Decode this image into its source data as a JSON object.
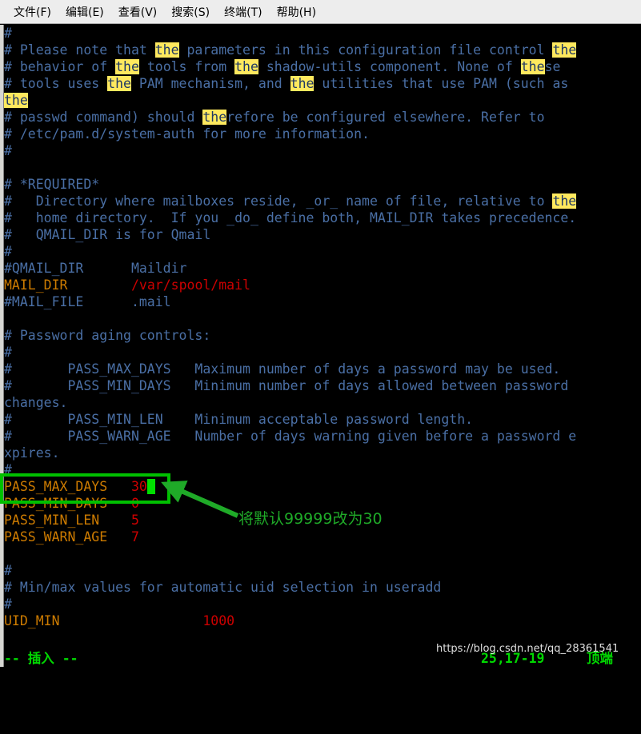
{
  "window": {
    "app": "terminal",
    "editor": "vim",
    "file_type": "login.defs"
  },
  "menubar": {
    "items": [
      {
        "label": "文件(F)",
        "name": "menu-file"
      },
      {
        "label": "编辑(E)",
        "name": "menu-edit"
      },
      {
        "label": "查看(V)",
        "name": "menu-view"
      },
      {
        "label": "搜索(S)",
        "name": "menu-search"
      },
      {
        "label": "终端(T)",
        "name": "menu-terminal"
      },
      {
        "label": "帮助(H)",
        "name": "menu-help"
      }
    ]
  },
  "terminal": {
    "background": "#000000",
    "comment_color": "#4a6fa5",
    "key_color": "#cd7b00",
    "value_color": "#cd0000",
    "search_highlight_bg": "#ffe95e",
    "search_highlight_fg": "#1f3864",
    "search_term": "the",
    "cursor_color": "#00e000",
    "lines": [
      "#",
      "# Please note that the parameters in this configuration file control the",
      "# behavior of the tools from the shadow-utils component. None of these",
      "# tools uses the PAM mechanism, and the utilities that use PAM (such as",
      "the",
      "# passwd command) should therefore be configured elsewhere. Refer to",
      "# /etc/pam.d/system-auth for more information.",
      "#",
      "",
      "# *REQUIRED*",
      "#   Directory where mailboxes reside, _or_ name of file, relative to the",
      "#   home directory.  If you _do_ define both, MAIL_DIR takes precedence.",
      "#   QMAIL_DIR is for Qmail",
      "#",
      "#QMAIL_DIR      Maildir",
      "MAIL_DIR        /var/spool/mail",
      "#MAIL_FILE      .mail",
      "",
      "# Password aging controls:",
      "#",
      "#       PASS_MAX_DAYS   Maximum number of days a password may be used.",
      "#       PASS_MIN_DAYS   Minimum number of days allowed between password",
      "changes.",
      "#       PASS_MIN_LEN    Minimum acceptable password length.",
      "#       PASS_WARN_AGE   Number of days warning given before a password e",
      "xpires.",
      "#",
      "PASS_MAX_DAYS   30",
      "PASS_MIN_DAYS   0",
      "PASS_MIN_LEN    5",
      "PASS_WARN_AGE   7",
      "",
      "#",
      "# Min/max values for automatic uid selection in useradd",
      "#",
      "UID_MIN                  1000"
    ],
    "settings": [
      {
        "key": "#QMAIL_DIR",
        "value": "Maildir",
        "commented": true
      },
      {
        "key": "MAIL_DIR",
        "value": "/var/spool/mail",
        "commented": false
      },
      {
        "key": "#MAIL_FILE",
        "value": ".mail",
        "commented": true
      },
      {
        "key": "PASS_MAX_DAYS",
        "value": "30",
        "commented": false
      },
      {
        "key": "PASS_MIN_DAYS",
        "value": "0",
        "commented": false
      },
      {
        "key": "PASS_MIN_LEN",
        "value": "5",
        "commented": false
      },
      {
        "key": "PASS_WARN_AGE",
        "value": "7",
        "commented": false
      },
      {
        "key": "UID_MIN",
        "value": "1000",
        "commented": false
      }
    ]
  },
  "statusline": {
    "mode": "-- 插入 --",
    "position": "25,17-19",
    "scroll": "顶端"
  },
  "watermark": {
    "text": "https://blog.csdn.net/qq_28361541"
  },
  "annotation": {
    "text": "将默认99999改为30",
    "color": "#1faa28",
    "box_color": "#00c000",
    "arrow_color": "#1faa28"
  }
}
